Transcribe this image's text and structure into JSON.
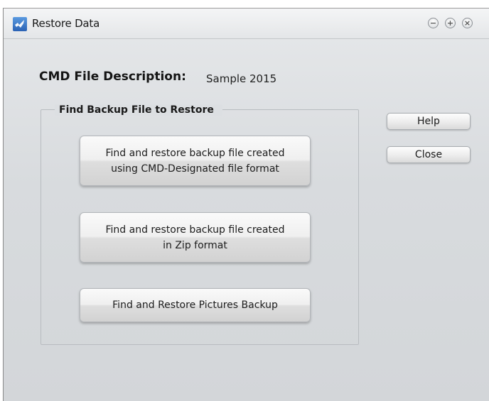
{
  "window": {
    "title": "Restore Data",
    "controls": {
      "minimize_glyph": "−",
      "maximize_glyph": "+",
      "close_glyph": "×"
    }
  },
  "description": {
    "label": "CMD File Description:",
    "value": "Sample 2015"
  },
  "group": {
    "legend": "Find Backup File to Restore",
    "buttons": [
      {
        "label": "Find and restore backup file created\nusing CMD-Designated file format"
      },
      {
        "label": "Find and restore backup file created\nin Zip format"
      },
      {
        "label": "Find and Restore Pictures Backup"
      }
    ]
  },
  "side_buttons": {
    "help": "Help",
    "close": "Close"
  },
  "icons": {
    "app": "app-logo-icon",
    "minimize": "minimize-icon",
    "maximize": "maximize-icon",
    "close": "close-icon"
  }
}
